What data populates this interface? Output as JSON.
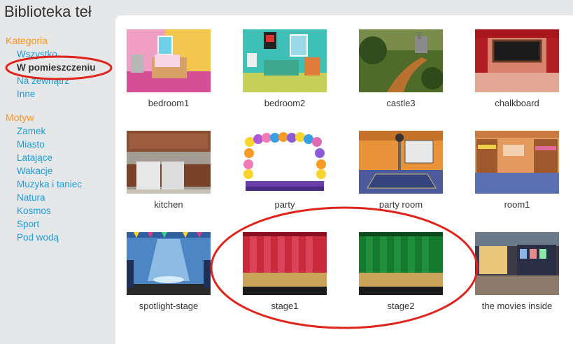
{
  "page": {
    "title": "Biblioteka teł"
  },
  "sidebar": {
    "category_heading": "Kategoria",
    "categories": [
      "Wszystko",
      "W pomieszczeniu",
      "Na zewnątrz",
      "Inne"
    ],
    "theme_heading": "Motyw",
    "themes": [
      "Zamek",
      "Miasto",
      "Latające",
      "Wakacje",
      "Muzyka i taniec",
      "Natura",
      "Kosmos",
      "Sport",
      "Pod wodą"
    ]
  },
  "library": {
    "items": [
      {
        "label": "bedroom1"
      },
      {
        "label": "bedroom2"
      },
      {
        "label": "castle3"
      },
      {
        "label": "chalkboard"
      },
      {
        "label": "kitchen"
      },
      {
        "label": "party"
      },
      {
        "label": "party room"
      },
      {
        "label": "room1"
      },
      {
        "label": "spotlight-stage"
      },
      {
        "label": "stage1"
      },
      {
        "label": "stage2"
      },
      {
        "label": "the movies inside"
      }
    ]
  },
  "colors": {
    "heading": "#f7941e",
    "link": "#1a9ddb",
    "annotation": "#e0241b"
  }
}
